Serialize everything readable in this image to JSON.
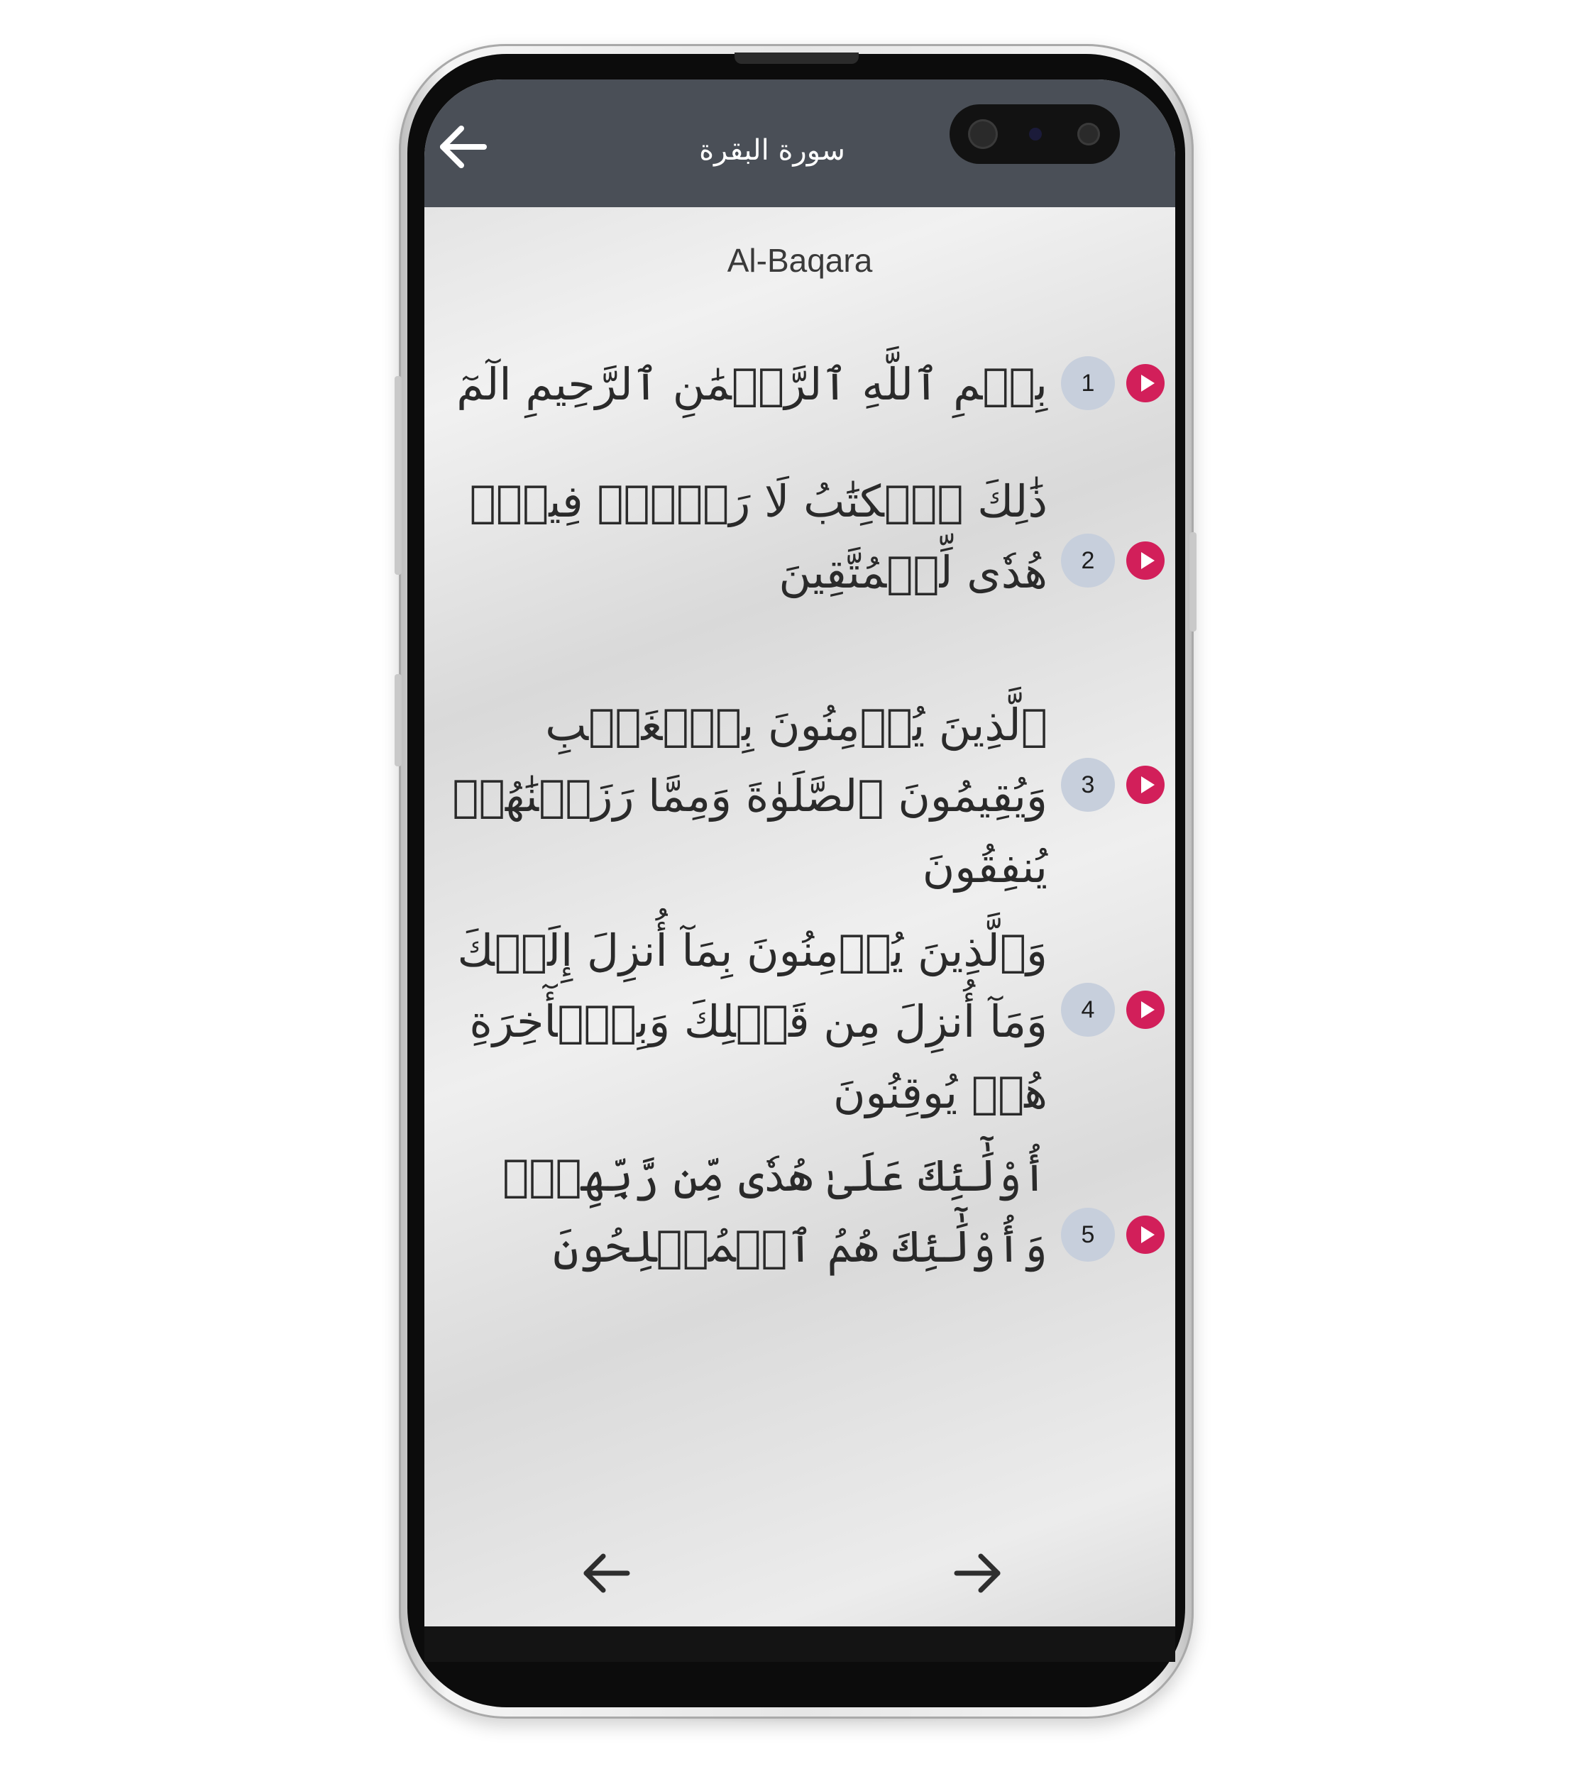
{
  "app_bar": {
    "title": "سورة البقرة",
    "background": "#4a4f57"
  },
  "surah": {
    "transliteration": "Al-Baqara"
  },
  "verses": [
    {
      "number": "1",
      "text": "بِسۡمِ ٱللَّهِ ٱلرَّحۡمَٰنِ ٱلرَّحِيمِ الٓمٓ"
    },
    {
      "number": "2",
      "text": "ذَٰلِكَ ٱلۡكِتَٰبُ لَا رَيۡبَۛ فِيهِۛ هُدٗى لِّلۡمُتَّقِينَ"
    },
    {
      "number": "3",
      "text": "ٱلَّذِينَ يُؤۡمِنُونَ بِٱلۡغَيۡبِ وَيُقِيمُونَ ٱلصَّلَوٰةَ وَمِمَّا رَزَقۡنَٰهُمۡ يُنفِقُونَ"
    },
    {
      "number": "4",
      "text": "وَٱلَّذِينَ يُؤۡمِنُونَ بِمَآ أُنزِلَ إِلَيۡكَ وَمَآ أُنزِلَ مِن قَبۡلِكَ وَبِٱلۡأٓخِرَةِ هُمۡ يُوقِنُونَ"
    },
    {
      "number": "5",
      "text": "أُوْلَٰٓئِكَ عَلَىٰ هُدٗى مِّن رَّبِّهِمۡۖ وَأُوْلَٰٓئِكَ هُمُ ٱلۡمُفۡلِحُونَ"
    }
  ],
  "icons": {
    "back": "arrow-left-icon",
    "play": "play-icon",
    "prev": "arrow-left-icon",
    "next": "arrow-right-icon"
  },
  "colors": {
    "accent": "#d21f5a",
    "verse_badge": "#c7cfdc"
  }
}
